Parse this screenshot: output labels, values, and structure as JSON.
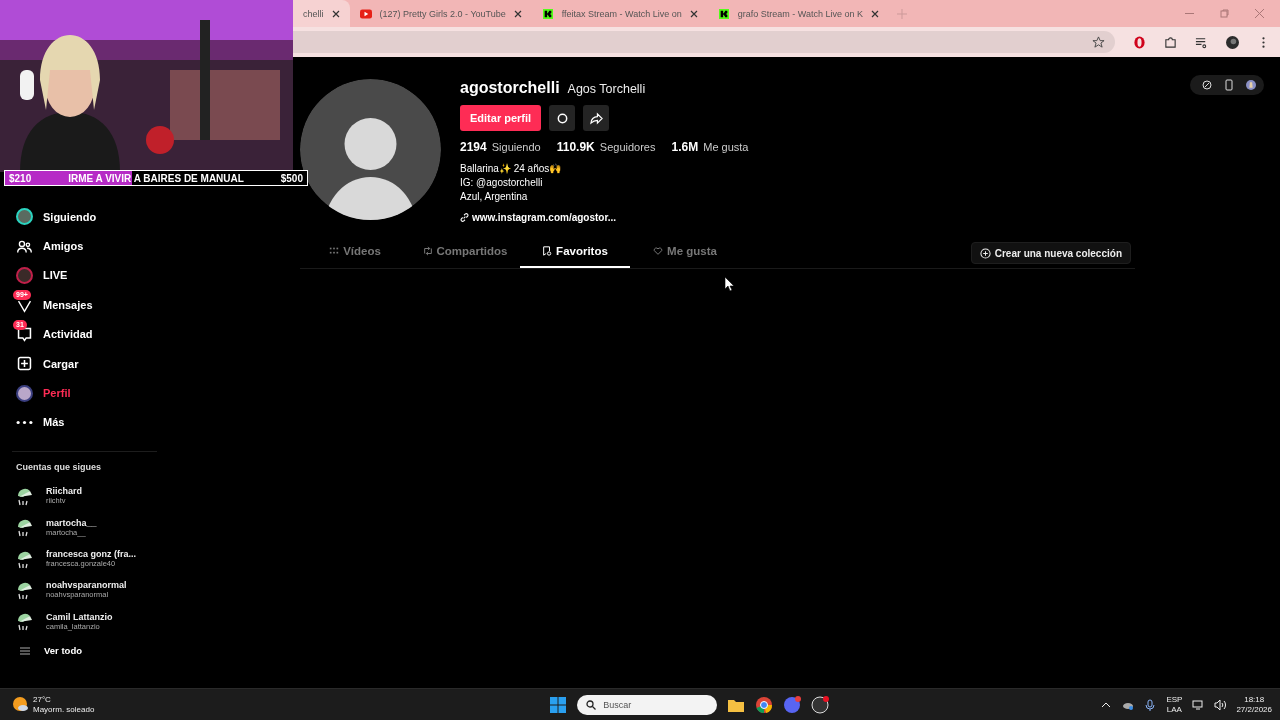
{
  "browser": {
    "tabs": [
      {
        "title": "chelli",
        "selected": true
      },
      {
        "title": "(127) Pretty Girls 2.0 - YouTube",
        "selected": false
      },
      {
        "title": "ffeitax Stream - Watch Live on",
        "selected": false
      },
      {
        "title": "grafo Stream - Watch Live on K",
        "selected": false
      }
    ]
  },
  "donation_goal": {
    "current": "$210",
    "title": "IRME A VIVIR A BAIRES DE MANUAL",
    "goal": "$500",
    "level": 0.42
  },
  "sidebar": {
    "items": [
      {
        "label": "Siguiendo",
        "selected": false
      },
      {
        "label": "Amigos",
        "selected": false
      },
      {
        "label": "LIVE",
        "selected": false
      },
      {
        "label": "Mensajes",
        "badge": "99+",
        "selected": false
      },
      {
        "label": "Actividad",
        "badge": "31",
        "selected": false
      },
      {
        "label": "Cargar",
        "selected": false
      },
      {
        "label": "Perfil",
        "selected": true
      },
      {
        "label": "Más",
        "selected": false
      }
    ],
    "following_title": "Cuentas que sigues",
    "accounts": [
      {
        "name": "Riichard",
        "handle": "riichtv"
      },
      {
        "name": "martocha__",
        "handle": "martocha__"
      },
      {
        "name": "francesca gonz (fra...",
        "handle": "francesca.gonzale40"
      },
      {
        "name": "noahvsparanormal",
        "handle": "noahvsparanormal"
      },
      {
        "name": "Camil Lattanzio",
        "handle": "camila_lattanzio"
      }
    ],
    "see_all": "Ver todo"
  },
  "profile": {
    "username": "agostorchelli",
    "display_name": "Agos Torchelli",
    "edit_button": "Editar perfil",
    "stats": [
      "**2194** Siguiendo",
      "**110.9K** Seguidores",
      "**1.6M** Me gusta"
    ],
    "bio": [
      "Ballarina✨ 24 años🙌",
      "IG: @agostorchelli",
      "Azul, Argentina"
    ],
    "link": "www.instagram.com/agostor..."
  },
  "profile_tabs": [
    {
      "label": "Vídeos",
      "selected": false
    },
    {
      "label": "Compartidos",
      "selected": false
    },
    {
      "label": "Favoritos",
      "selected": true
    },
    {
      "label": "Me gusta",
      "selected": false
    }
  ],
  "new_collection": "Crear una nueva colección",
  "taskbar": {
    "temperature": "27°C",
    "weather": "Mayorm. soleado",
    "search_placeholder": "Buscar",
    "language": "ESP",
    "layout": "LAA",
    "time": "18:18",
    "date": "27/2/2026"
  }
}
